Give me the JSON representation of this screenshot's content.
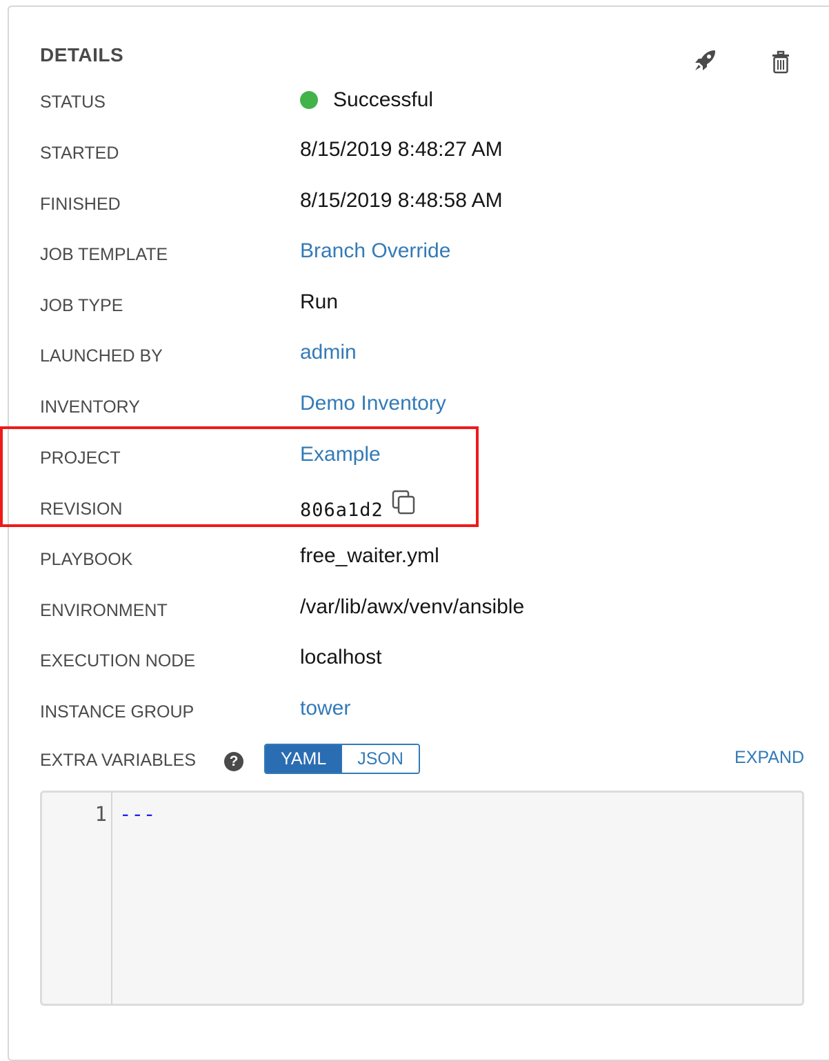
{
  "details": {
    "title": "DETAILS",
    "fields": {
      "status": {
        "label": "STATUS",
        "value": "Successful",
        "color": "#41b349"
      },
      "started": {
        "label": "STARTED",
        "value": "8/15/2019 8:48:27 AM"
      },
      "finished": {
        "label": "FINISHED",
        "value": "8/15/2019 8:48:58 AM"
      },
      "job_template": {
        "label": "JOB TEMPLATE",
        "value": "Branch Override"
      },
      "job_type": {
        "label": "JOB TYPE",
        "value": "Run"
      },
      "launched_by": {
        "label": "LAUNCHED BY",
        "value": "admin"
      },
      "inventory": {
        "label": "INVENTORY",
        "value": "Demo Inventory"
      },
      "project": {
        "label": "PROJECT",
        "value": "Example"
      },
      "revision": {
        "label": "REVISION",
        "value": "806a1d2"
      },
      "playbook": {
        "label": "PLAYBOOK",
        "value": "free_waiter.yml"
      },
      "environment": {
        "label": "ENVIRONMENT",
        "value": "/var/lib/awx/venv/ansible"
      },
      "execution_node": {
        "label": "EXECUTION NODE",
        "value": "localhost"
      },
      "instance_group": {
        "label": "INSTANCE GROUP",
        "value": "tower"
      }
    },
    "extra_variables": {
      "label": "EXTRA VARIABLES",
      "help_glyph": "?",
      "toggle": {
        "yaml": "YAML",
        "json": "JSON",
        "active": "YAML"
      },
      "expand_label": "EXPAND",
      "editor": {
        "line_number": "1",
        "line_text": "---"
      }
    }
  },
  "icons": {
    "launch": "rocket-icon",
    "delete": "trash-icon",
    "copy": "copy-icon",
    "help": "question-circle-icon"
  },
  "colors": {
    "link": "#337ab7",
    "accent": "#2a6db3",
    "highlight": "#ee1a1a",
    "success": "#41b349"
  }
}
